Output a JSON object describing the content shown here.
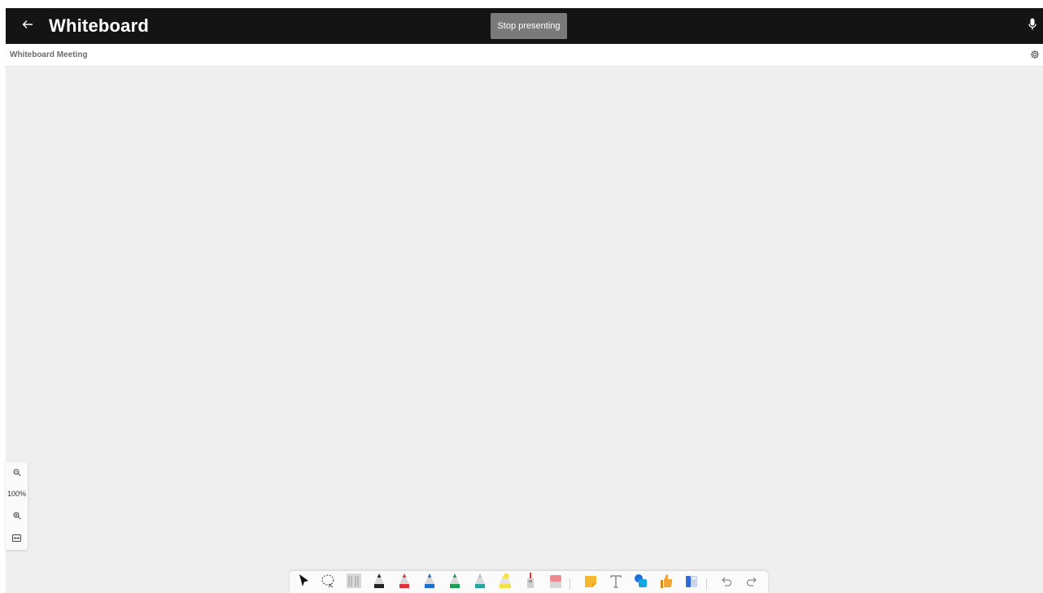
{
  "header": {
    "back_icon": "arrow-left-icon",
    "title": "Whiteboard",
    "stop_presenting_label": "Stop presenting",
    "mic_icon": "microphone-icon"
  },
  "subheader": {
    "meeting_title": "Whiteboard Meeting",
    "settings_icon": "gear-icon"
  },
  "zoom": {
    "zoom_out_icon": "zoom-out-icon",
    "level": "100%",
    "zoom_in_icon": "zoom-in-icon",
    "fit_icon": "fit-to-screen-icon"
  },
  "toolbar": {
    "tools": [
      {
        "name": "select-tool",
        "icon": "cursor-arrow-icon"
      },
      {
        "name": "lasso-tool",
        "icon": "lasso-select-icon"
      },
      {
        "name": "ruler-tool",
        "icon": "ruler-icon"
      },
      {
        "name": "pen-black",
        "icon": "pen-icon",
        "color": "#222222"
      },
      {
        "name": "pen-red",
        "icon": "pen-icon",
        "color": "#e0343a"
      },
      {
        "name": "pen-blue",
        "icon": "pen-icon",
        "color": "#1f6fd1"
      },
      {
        "name": "pen-green",
        "icon": "pen-icon",
        "color": "#1f9d55"
      },
      {
        "name": "pen-teal",
        "icon": "pen-icon",
        "color": "#2aa3a3"
      },
      {
        "name": "highlighter-yellow",
        "icon": "highlighter-icon",
        "color": "#f6e04a"
      },
      {
        "name": "laser-pointer",
        "icon": "laser-pointer-icon",
        "color": "#e0343a"
      },
      {
        "name": "eraser-tool",
        "icon": "eraser-icon",
        "color": "#ee8a8f"
      },
      {
        "name": "sticky-note-tool",
        "icon": "sticky-note-icon",
        "color": "#f7b731"
      },
      {
        "name": "text-tool",
        "icon": "text-icon"
      },
      {
        "name": "shapes-tool",
        "icon": "shapes-icon",
        "color": "#1e6fd9"
      },
      {
        "name": "reactions-tool",
        "icon": "thumbs-up-icon",
        "color": "#f0a534"
      },
      {
        "name": "templates-tool",
        "icon": "templates-icon",
        "color": "#2e6bd6"
      },
      {
        "name": "undo-button",
        "icon": "undo-icon"
      },
      {
        "name": "redo-button",
        "icon": "redo-icon"
      }
    ]
  },
  "colors": {
    "topbar": "#141414",
    "canvas": "#efefef",
    "stop_button": "#7a7a7a"
  }
}
